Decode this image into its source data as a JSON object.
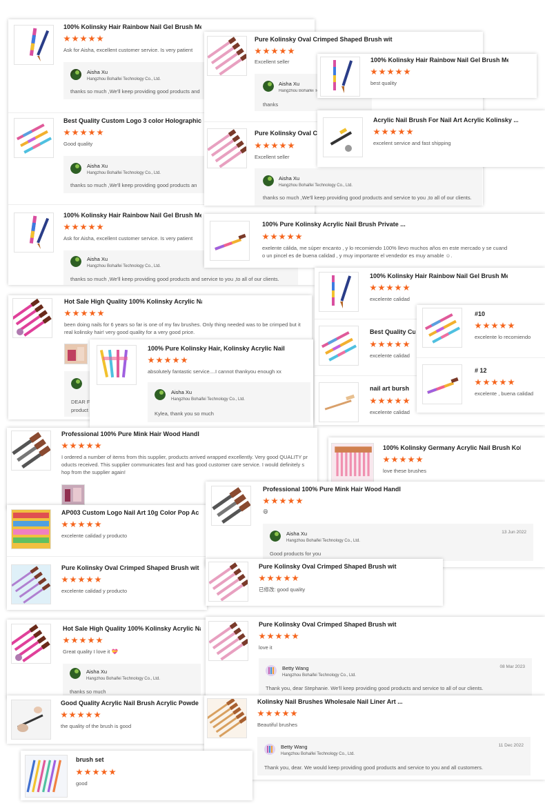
{
  "titles": {
    "rainbow_gel": "100% Kolinsky Hair Rainbow Nail Gel Brush Me...",
    "oval_crimped": "Pure Kolinsky Oval Crimped Shaped Brush with...",
    "oval_crimped_cut": "Pure Kolinsky Oval Cri",
    "acrylic_nail_art": "Acrylic Nail Brush For Nail Art Acrylic Kolinsky ...",
    "best_quality_custom": "Best Quality Custom Logo 3 color Holographic ...",
    "best_quality_cut": "Best Quality Cust",
    "pure_private": "100% Pure Kolinsky Acrylic Nail Brush Private ...",
    "hot_sale": "Hot Sale High Quality 100% Kolinsky Acrylic Na...",
    "pure_kolinsky_hair": "100% Pure Kolinsky Hair, Kolinsky Acrylic Nail ...",
    "num10": "#10",
    "num12": "# 12",
    "nail_art_bursh": "nail art bursh",
    "professional_mink": "Professional 100% Pure Mink Hair Wood Handl...",
    "germany": "100% Kolinsky Germany Acrylic Nail Brush Koli...",
    "ap003": "AP003 Custom Logo Nail Art 10g Color Pop Ac...",
    "good_quality_powder": "Good Quality Acrylic Nail Brush Acrylic Powder...",
    "wholesale_liner": "Kolinsky Nail Brushes Wholesale Nail Liner Art ...",
    "brush_set": "brush set"
  },
  "reviews": {
    "ask_aisha": "Ask for Aisha, excellent customer service. Is very patient",
    "excellent_seller": "Excellent seller",
    "best_quality": "best quality",
    "excellent_fast": "excelent service and fast shipping",
    "good_quality": "Good quality",
    "exelente_long_1": "exelente cálida,  me súper encanto , y lo recomiendo 100% llevo muchos años en este mercado y se cuand",
    "exelente_long_2": "o un pincel es de buena calidad , y muy importante el vendedor es muy amable ☺.",
    "excelente_calidad": "excelente calidad",
    "doing_nails_1": "been doing nails for 6 years so far is one of my fav brushes. Only thing needed was to be crimped but it",
    "doing_nails_2": "real kolinsky hair! very good quality for a very good price.",
    "fantastic": "absolutely fantastic service....I cannot thankyou enough xx",
    "recomiendo": "excelente lo recomiendo",
    "buena_calidad": "excelente , buena calidad",
    "ordered_1": "I ordered a number of items from this supplier, products arrived wrapped excellently. Very good QUALITY pr",
    "ordered_2": "oducts received. This supplier communicates fast and has good customer care service. I would definitely s",
    "ordered_3": "hop from the supplier again!",
    "love_these": "love these brushes",
    "emoji_face": "😄",
    "calidad_producto": "excelente calidad y producto",
    "modified_good": "已修改: good quality",
    "great_love": "Great quality I love it 💝",
    "love_it": "love it",
    "quality_good": "the quality of the brush is good",
    "beautiful": "Beautiful brushes",
    "good": "good"
  },
  "replies": {
    "aisha_name": "Aisha Xu",
    "betty_name": "Betty Wang",
    "company": "Hangzhou Bohaifei Technology Co., Ltd.",
    "thanks_full": "thanks so much ,We'll keep providing good products and service to you ,to all of our clients.",
    "thanks_cut_a": "thanks so much ,We'll keep providing good products and",
    "thanks_cut_b": "thanks so much ,We'll keep providing good products an",
    "thanks_short": "thanks",
    "kylea": "Kylea, thank you so much",
    "dear_f": "DEAR F",
    "product": "product",
    "good_products": "Good products for you",
    "date_jun": "13 Jun 2022",
    "stephanie": "Thank you, dear Stephanie. We'll keep providing good products and service to all of our clients.",
    "date_mar": "08 Mar 2023",
    "thank_dear": "Thank you, dear. We would keep providing good products and service to you and all customers.",
    "date_dec": "11 Dec 2022",
    "thanks_much": "thanks so much"
  },
  "colors": {
    "star": "#f5661f",
    "accent_orange": "#f5661f"
  }
}
